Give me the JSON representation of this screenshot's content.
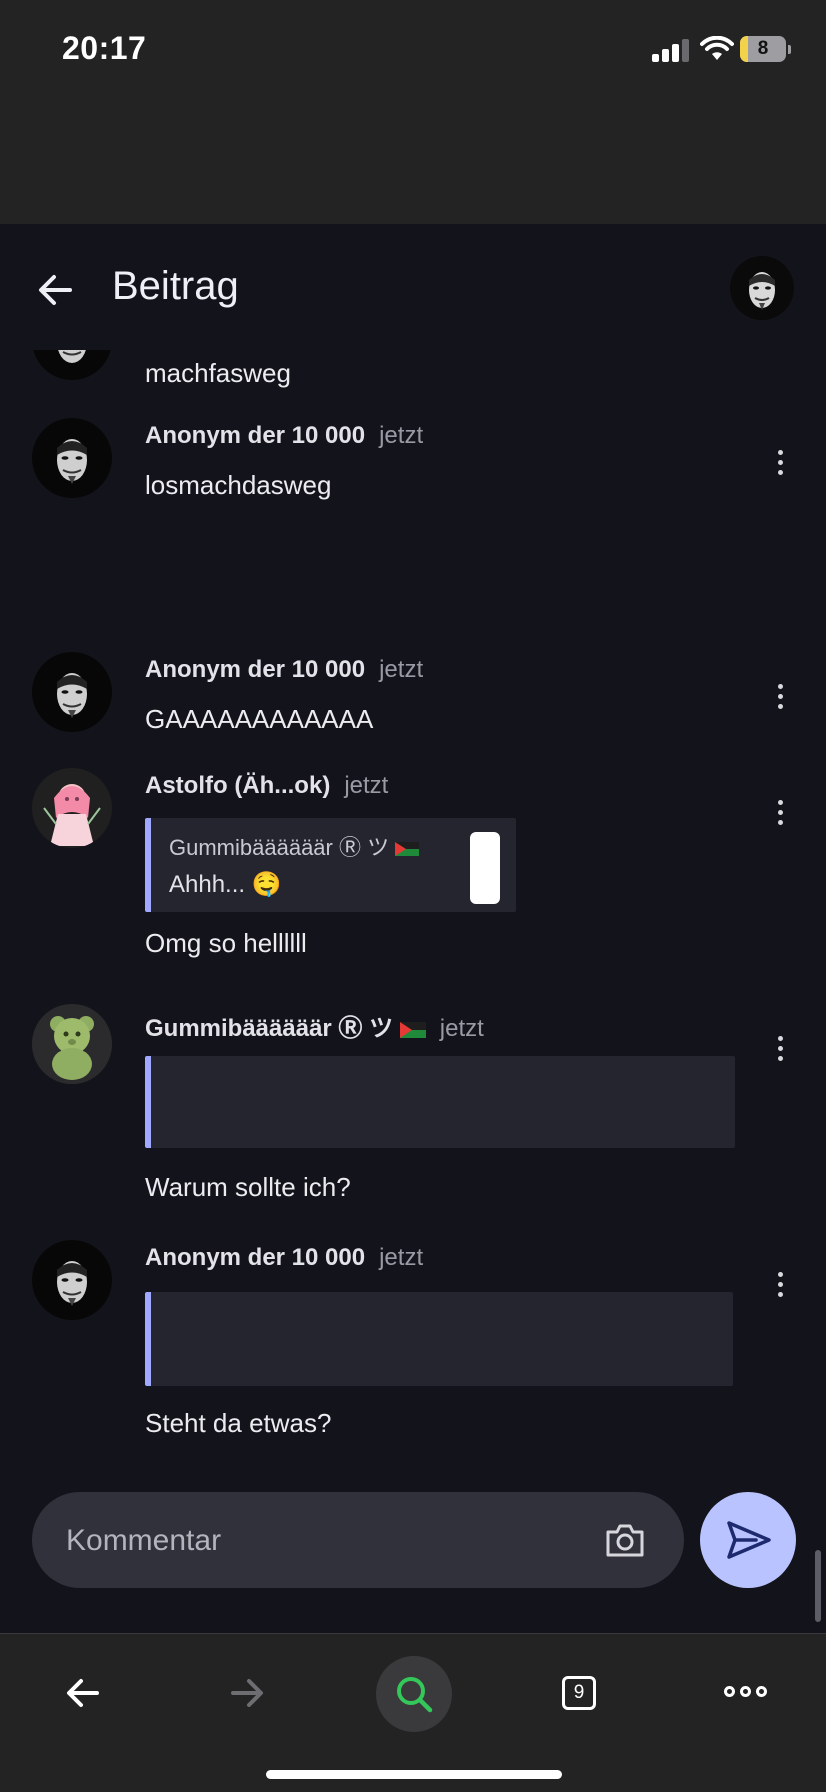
{
  "status_bar": {
    "time": "20:17",
    "battery_level": "8",
    "signal_bars": 3,
    "icons": [
      "cellular-signal-icon",
      "wifi-icon",
      "battery-icon"
    ]
  },
  "header": {
    "title": "Beitrag",
    "icons": [
      "back-arrow-icon",
      "profile-avatar"
    ]
  },
  "comments": [
    {
      "author": "",
      "time": "",
      "text": "machfasweg"
    },
    {
      "author": "Anonym der 10 000",
      "time": "jetzt",
      "text": "losmachdasweg"
    },
    {
      "author": "Anonym der 10 000",
      "time": "jetzt",
      "text": "GAAAAAAAAAAAA"
    },
    {
      "author": "Astolfo (Äh...ok)",
      "time": "jetzt",
      "text": "Omg so hellllll",
      "quote": {
        "author": "Gummibäääääär Ⓡ ツ",
        "text": "Ahhh... 🤤"
      }
    },
    {
      "author": "Gummibäääääär Ⓡ ツ",
      "time": "jetzt",
      "text": "Warum sollte ich?"
    },
    {
      "author": "Anonym der 10 000",
      "time": "jetzt",
      "text": "Steht da etwas?"
    }
  ],
  "composer": {
    "placeholder": "Kommentar",
    "icons": [
      "camera-icon",
      "send-icon"
    ]
  },
  "browser_bar": {
    "tab_count": "9",
    "icons": [
      "nav-back-icon",
      "nav-forward-icon",
      "search-icon",
      "tabs-icon",
      "more-menu-icon"
    ]
  },
  "colors": {
    "background": "#13141b",
    "accent": "#b9c3ff",
    "quote_bar": "#9ea9ff",
    "search_accent": "#34c759"
  }
}
